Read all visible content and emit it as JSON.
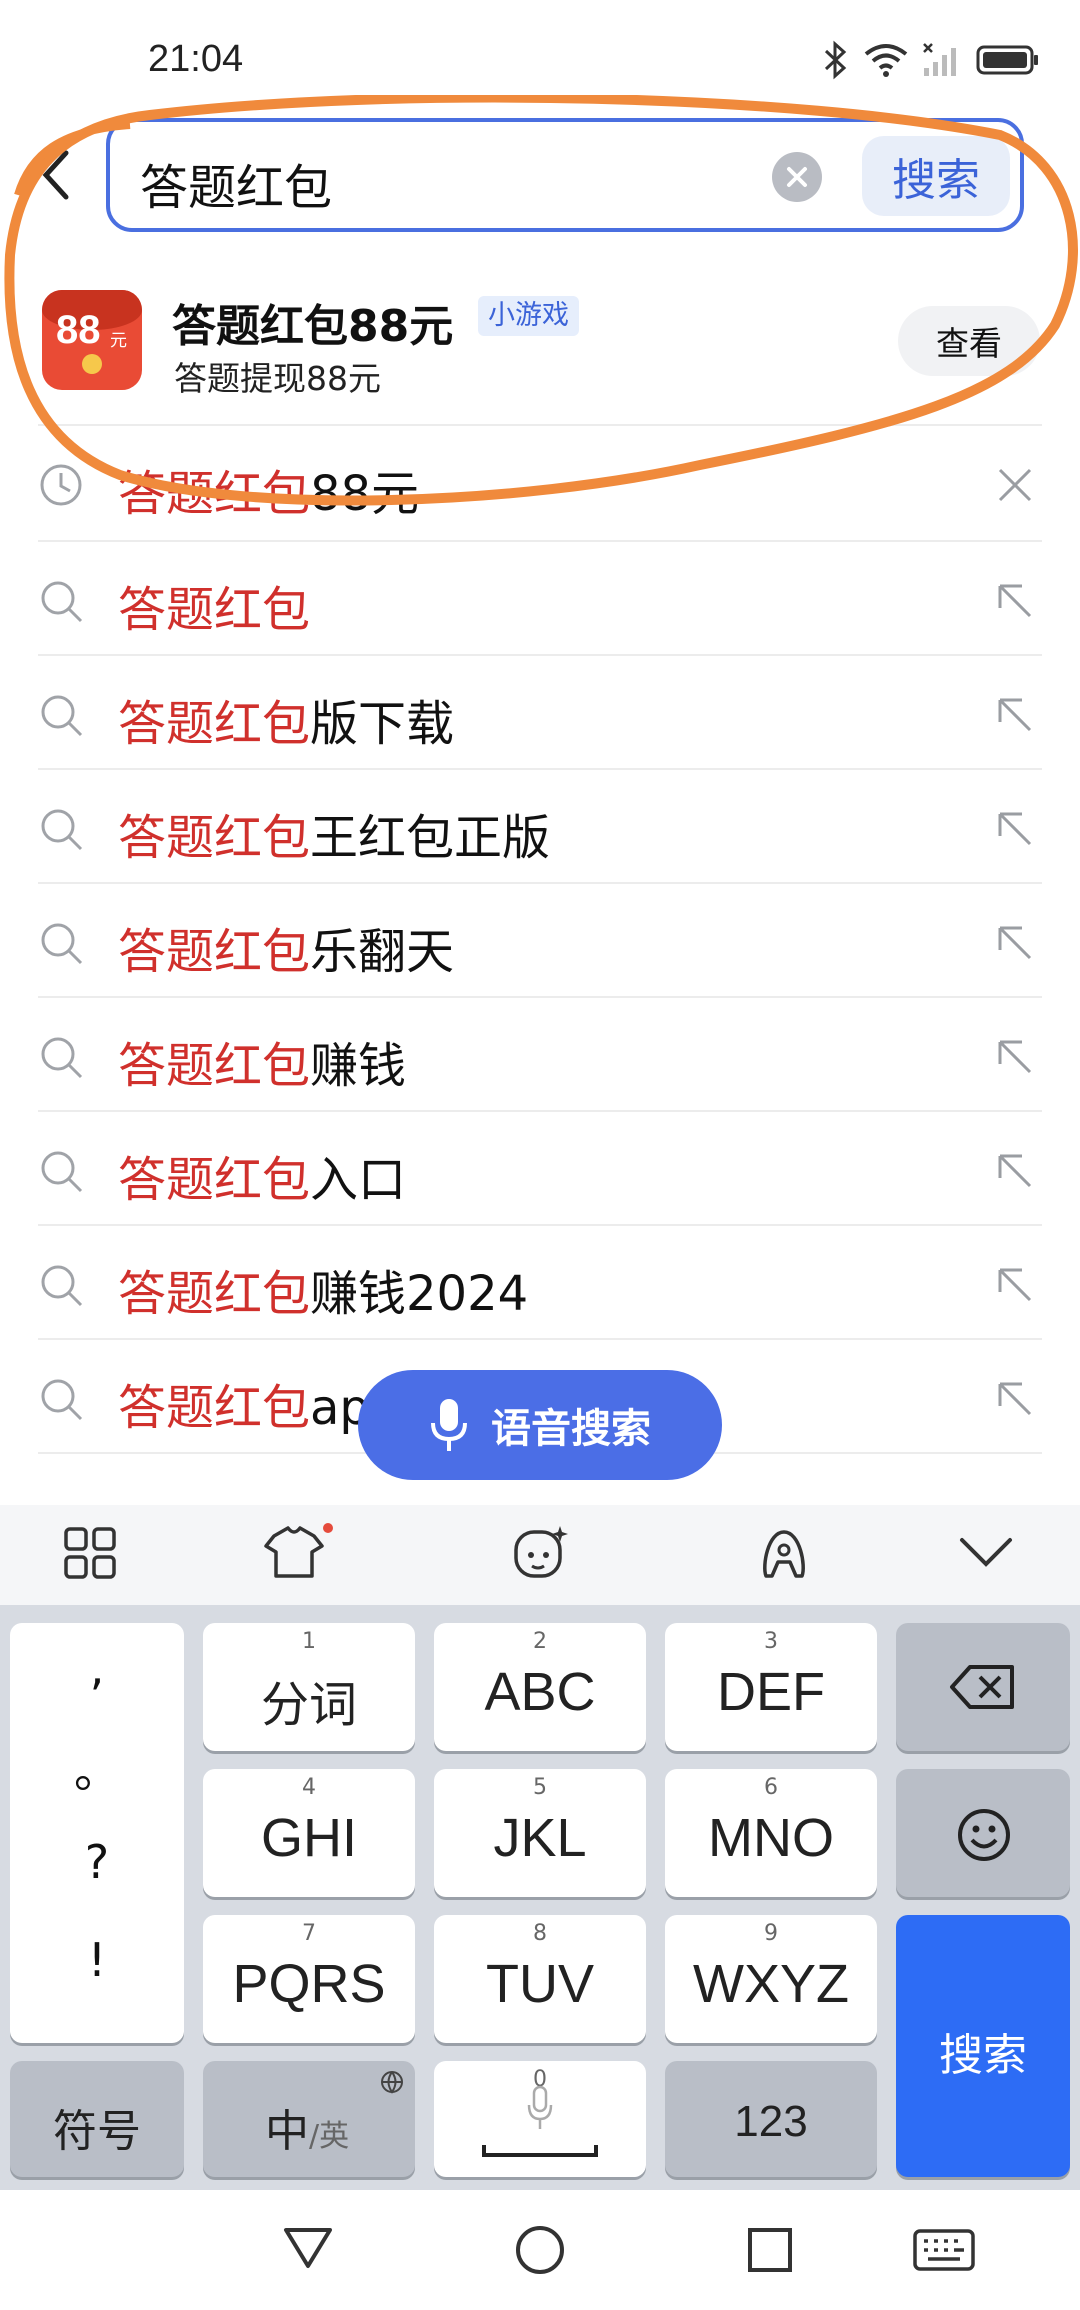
{
  "status": {
    "time": "21:04"
  },
  "search": {
    "query": "答题红包",
    "button_label": "搜索"
  },
  "mini_game": {
    "title": "答题红包88元",
    "tag": "小游戏",
    "subtitle": "答题提现88元",
    "view_label": "查看",
    "logo_text": "88",
    "logo_unit": "元"
  },
  "history": {
    "highlight": "答题红包",
    "rest": "88元"
  },
  "suggestions": [
    {
      "highlight": "答题红包",
      "rest": ""
    },
    {
      "highlight": "答题红包",
      "rest": "版下载"
    },
    {
      "highlight": "答题红包",
      "rest": "王红包正版"
    },
    {
      "highlight": "答题红包",
      "rest": "乐翻天"
    },
    {
      "highlight": "答题红包",
      "rest": "赚钱"
    },
    {
      "highlight": "答题红包",
      "rest": "入口"
    },
    {
      "highlight": "答题红包",
      "rest": "赚钱2024"
    },
    {
      "highlight": "答题红包",
      "rest": "ap"
    }
  ],
  "voice_search": {
    "label": "语音搜索"
  },
  "keyboard": {
    "punct": [
      ",",
      "。",
      "?",
      "!"
    ],
    "keys": {
      "k1": {
        "num": "1",
        "label": "分词"
      },
      "k2": {
        "num": "2",
        "label": "ABC"
      },
      "k3": {
        "num": "3",
        "label": "DEF"
      },
      "k4": {
        "num": "4",
        "label": "GHI"
      },
      "k5": {
        "num": "5",
        "label": "JKL"
      },
      "k6": {
        "num": "6",
        "label": "MNO"
      },
      "k7": {
        "num": "7",
        "label": "PQRS"
      },
      "k8": {
        "num": "8",
        "label": "TUV"
      },
      "k9": {
        "num": "9",
        "label": "WXYZ"
      },
      "k0": {
        "num": "0"
      }
    },
    "symbols_label": "符号",
    "lang_main": "中",
    "lang_alt": "/英",
    "num_label": "123",
    "enter_label": "搜索"
  },
  "colors": {
    "accent": "#4b6ee6",
    "highlight": "#d0302c",
    "annotation": "#f08a3c"
  }
}
